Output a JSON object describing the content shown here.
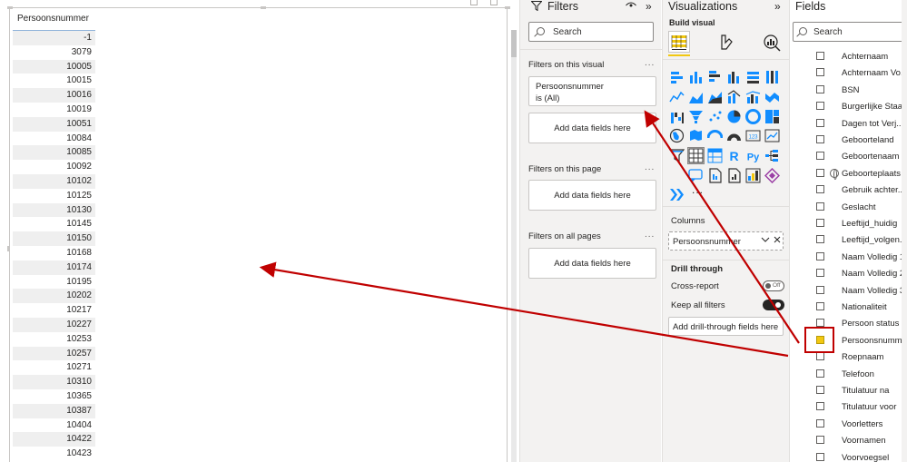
{
  "table": {
    "column_header": "Persoonsnummer",
    "rows": [
      "-1",
      "3079",
      "10005",
      "10015",
      "10016",
      "10019",
      "10051",
      "10084",
      "10085",
      "10092",
      "10102",
      "10125",
      "10130",
      "10145",
      "10150",
      "10168",
      "10174",
      "10195",
      "10202",
      "10217",
      "10227",
      "10253",
      "10257",
      "10271",
      "10310",
      "10365",
      "10387",
      "10404",
      "10422",
      "10423"
    ]
  },
  "filters": {
    "title": "Filters",
    "search_placeholder": "Search",
    "on_visual_label": "Filters on this visual",
    "filter_card": {
      "field": "Persoonsnummer",
      "state": "is (All)"
    },
    "add_fields_label": "Add data fields here",
    "on_page_label": "Filters on this page",
    "on_all_pages_label": "Filters on all pages",
    "more_dots": "..."
  },
  "visualizations": {
    "title": "Visualizations",
    "build_visual_label": "Build visual",
    "columns_label": "Columns",
    "column_field": "Persoonsnummer",
    "drill_through_label": "Drill through",
    "cross_report_label": "Cross-report",
    "cross_report_state": "Off",
    "keep_filters_label": "Keep all filters",
    "add_drill_label": "Add drill-through fields here",
    "r_label": "R",
    "py_label": "Py",
    "num_label": "123",
    "more_label": "...",
    "icon_names": [
      "stacked-bar-icon",
      "stacked-column-icon",
      "clustered-bar-icon",
      "clustered-column-icon",
      "100-bar-icon",
      "100-column-icon",
      "line-chart-icon",
      "area-chart-icon",
      "stacked-area-icon",
      "line-column-icon",
      "line-clustered-icon",
      "ribbon-chart-icon",
      "waterfall-icon",
      "funnel-icon",
      "scatter-icon",
      "pie-icon",
      "donut-icon",
      "treemap-icon",
      "map-icon",
      "filled-map-icon",
      "azure-map-icon",
      "gauge-icon",
      "card-icon",
      "kpi-icon",
      "slicer-icon",
      "table-icon",
      "matrix-icon",
      "r-visual-icon",
      "python-visual-icon",
      "decomposition-tree-icon",
      "key-influencers-icon",
      "qa-icon",
      "paginated-report-icon",
      "smart-narrative-icon",
      "power-apps-icon",
      "power-automate-icon"
    ]
  },
  "fields": {
    "title": "Fields",
    "search_placeholder": "Search",
    "items": [
      {
        "label": "Achternaam",
        "checked": false
      },
      {
        "label": "Achternaam Vo...",
        "checked": false
      },
      {
        "label": "BSN",
        "checked": false
      },
      {
        "label": "Burgerlijke Staat",
        "checked": false
      },
      {
        "label": "Dagen tot Verj...",
        "checked": false
      },
      {
        "label": "Geboorteland",
        "checked": false
      },
      {
        "label": "Geboortenaam",
        "checked": false
      },
      {
        "label": "Geboorteplaats",
        "checked": false,
        "geo": true
      },
      {
        "label": "Gebruik achter...",
        "checked": false
      },
      {
        "label": "Geslacht",
        "checked": false
      },
      {
        "label": "Leeftijd_huidig",
        "checked": false
      },
      {
        "label": "Leeftijd_volgen...",
        "checked": false
      },
      {
        "label": "Naam Volledig 1",
        "checked": false
      },
      {
        "label": "Naam Volledig 2",
        "checked": false
      },
      {
        "label": "Naam Volledig 3",
        "checked": false
      },
      {
        "label": "Nationaliteit",
        "checked": false
      },
      {
        "label": "Persoon status",
        "checked": false
      },
      {
        "label": "Persoonsnumm...",
        "checked": true
      },
      {
        "label": "Roepnaam",
        "checked": false
      },
      {
        "label": "Telefoon",
        "checked": false
      },
      {
        "label": "Titulatuur na",
        "checked": false
      },
      {
        "label": "Titulatuur voor",
        "checked": false
      },
      {
        "label": "Voorletters",
        "checked": false
      },
      {
        "label": "Voornamen",
        "checked": false
      },
      {
        "label": "Voorvoegsel",
        "checked": false
      }
    ]
  },
  "colors": {
    "accent_yellow": "#f2c811",
    "annotation_red": "#c00000",
    "viz_blue": "#118dff"
  }
}
